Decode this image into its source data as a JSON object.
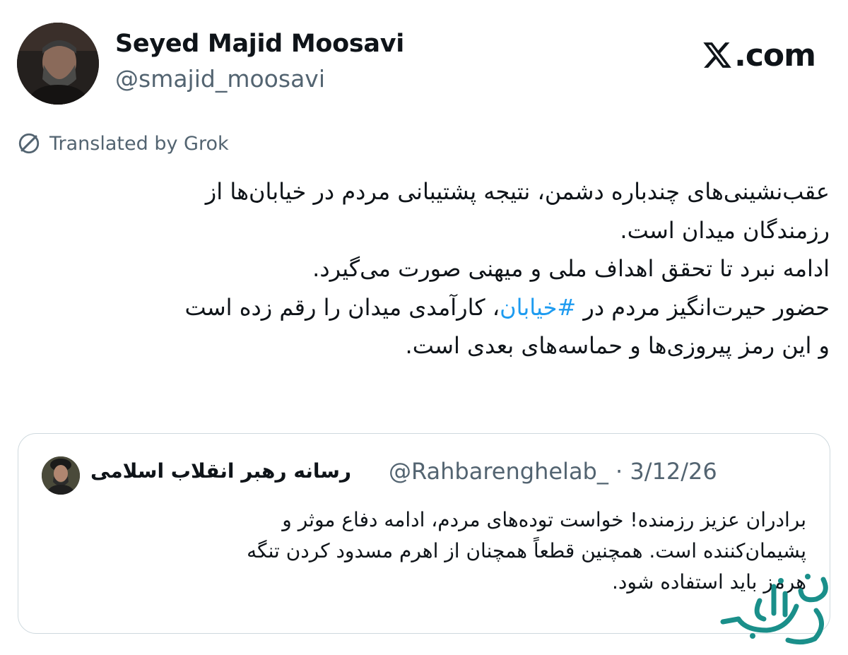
{
  "author": {
    "display_name": "Seyed Majid Moosavi",
    "handle": "@smajid_moosavi",
    "avatar_icon": "profile-photo"
  },
  "brand": {
    "x_logo_icon": "x-logo-icon",
    "label": ".com"
  },
  "translation": {
    "icon": "translate-icon",
    "label": "Translated by Grok"
  },
  "tweet": {
    "lines": [
      "عقب‌نشینی‌های چندباره دشمن، نتیجه پشتیبانی مردم در خیابان‌ها از",
      "رزمندگان میدان است.",
      "ادامه نبرد تا تحقق اهداف ملی و میهنی صورت می‌گیرد.",
      "حضور حیرت‌انگیز مردم در ",
      "، کارآمدی میدان را رقم زده است",
      "و این رمز پیروزی‌ها و حماسه‌های بعدی است."
    ],
    "hashtag": "#خیابان"
  },
  "quoted_tweet": {
    "display_name": "رسانه رهبر انقلاب اسلامی",
    "meta": "@Rahbarenghelab_ · 3/12/26",
    "lines": [
      "برادران عزیز رزمنده! خواست توده‌های مردم، ادامه دفاع موثر و",
      "پشیمان‌کننده است. همچنین قطعاً همچنان از اهرم مسدود کردن تنگه",
      "هرمز باید استفاده شود."
    ]
  },
  "watermark": {
    "text": "صفحه اقتصاد",
    "color": "#1a8f8a"
  },
  "colors": {
    "text": "#0f1419",
    "muted": "#536471",
    "link": "#1d9bf0",
    "border": "#cfd9de"
  }
}
